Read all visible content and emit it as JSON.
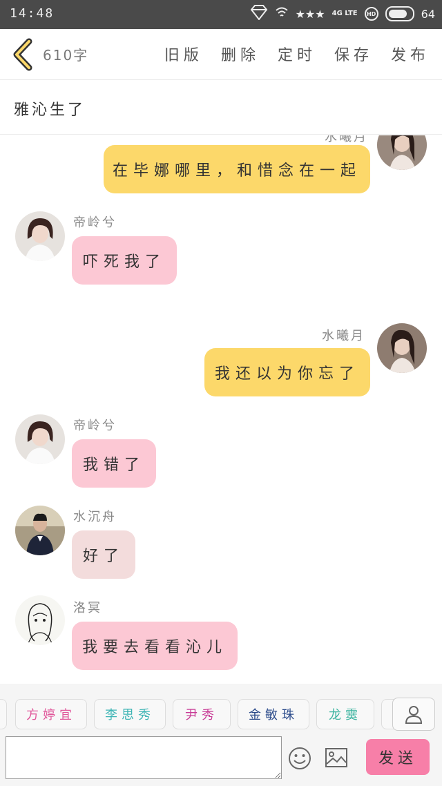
{
  "status_bar": {
    "time": "14:48",
    "network": "4G LTE",
    "hd": "HD",
    "battery": "64"
  },
  "header": {
    "word_count": "610字",
    "actions": [
      "旧版",
      "删除",
      "定时",
      "保存",
      "发布"
    ]
  },
  "title": "雅沁生了",
  "messages": [
    {
      "side": "right",
      "name": "水曦月",
      "text": "在毕娜哪里，和惜念在一起",
      "color": "#fcd86a"
    },
    {
      "side": "left",
      "name": "帝岭兮",
      "text": "吓死我了",
      "color": "#fcc8d4"
    },
    {
      "side": "right",
      "name": "水曦月",
      "text": "我还以为你忘了",
      "color": "#fcd86a"
    },
    {
      "side": "left",
      "name": "帝岭兮",
      "text": "我错了",
      "color": "#fcc8d4"
    },
    {
      "side": "left",
      "name": "水沉舟",
      "text": "好了",
      "color": "#f3dcdc"
    },
    {
      "side": "left",
      "name": "洛冥",
      "text": "我要去看看沁儿",
      "color": "#fcc8d4"
    }
  ],
  "characters": [
    {
      "label": "方婷宜",
      "color": "#e0569a"
    },
    {
      "label": "李思秀",
      "color": "#3cb4b4"
    },
    {
      "label": "尹秀",
      "color": "#c83c96"
    },
    {
      "label": "金敏珠",
      "color": "#2a4a8a"
    },
    {
      "label": "龙霙",
      "color": "#3cb4a0"
    }
  ],
  "input": {
    "placeholder": "",
    "value": ""
  },
  "send_label": "发送",
  "colors": {
    "accent_pink": "#f77fa8",
    "bubble_yellow": "#fcd86a",
    "bubble_pink": "#fcc8d4"
  }
}
